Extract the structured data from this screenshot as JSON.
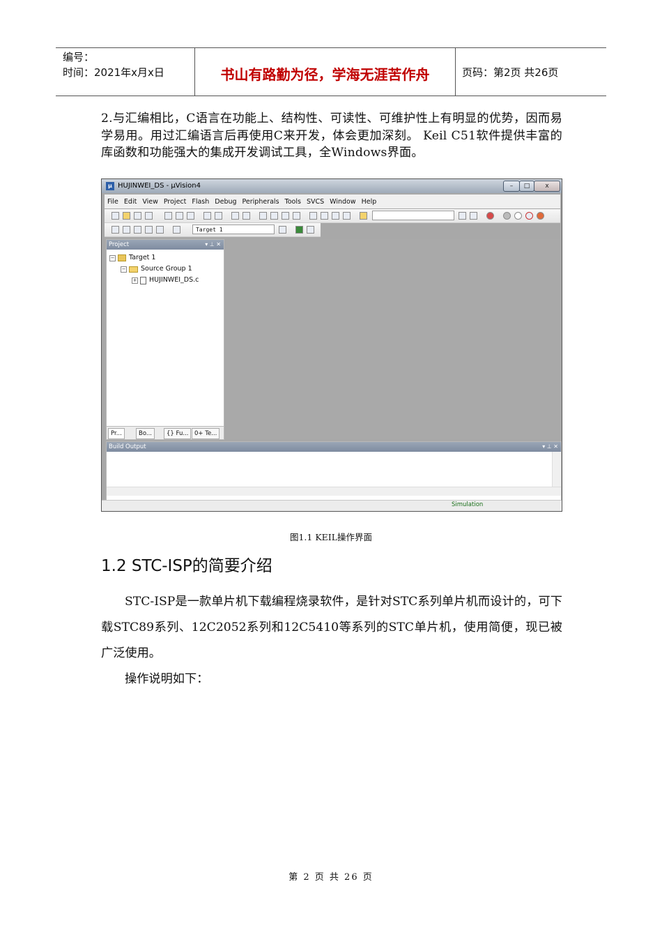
{
  "header": {
    "number_label": "编号：",
    "time_label": "时间：2021年x月x日",
    "motto": "书山有路勤为径，学海无涯苦作舟",
    "page_info": "页码：第2页  共26页"
  },
  "intro_paragraph": "2.与汇编相比，C语言在功能上、结构性、可读性、可维护性上有明显的优势，因而易学易用。用过汇编语言后再使用C来开发，体会更加深刻。  Keil C51软件提供丰富的库函数和功能强大的集成开发调试工具，全Windows界面。",
  "screenshot": {
    "window_title": "HUJINWEI_DS - μVision4",
    "window_buttons": [
      "–",
      "□",
      "x"
    ],
    "menus": [
      "File",
      "Edit",
      "View",
      "Project",
      "Flash",
      "Debug",
      "Peripherals",
      "Tools",
      "SVCS",
      "Window",
      "Help"
    ],
    "target_dropdown": "Target 1",
    "project_panel_title": "Project",
    "panel_controls": "▾ ⊥ ✕",
    "tree": {
      "target": "Target 1",
      "group": "Source Group 1",
      "file": "HUJINWEI_DS.c"
    },
    "tabs": [
      "Pr...",
      "Bo...",
      "{} Fu...",
      "0+ Te..."
    ],
    "build_output_title": "Build Output",
    "status_text": "Simulation"
  },
  "figure_caption": "图1.1 KEIL操作界面",
  "section_heading": "1.2 STC-ISP的简要介绍",
  "section_paragraphs": [
    "STC-ISP是一款单片机下载编程烧录软件，是针对STC系列单片机而设计的，可下载STC89系列、12C2052系列和12C5410等系列的STC单片机，使用简便，现已被广泛使用。",
    "操作说明如下："
  ],
  "footer": "第 2 页 共 26 页"
}
